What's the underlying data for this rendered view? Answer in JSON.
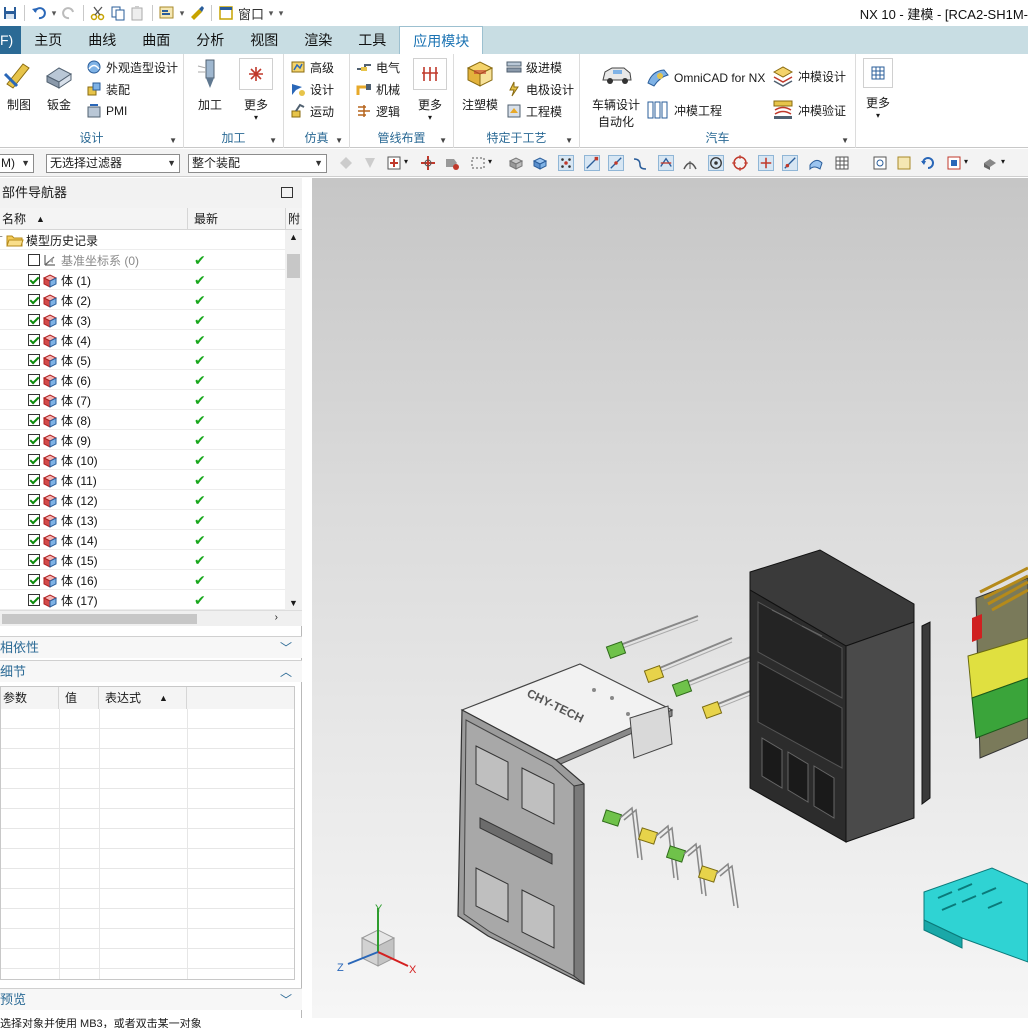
{
  "titlebar": {
    "window_label": "窗口",
    "title": "NX 10 - 建模 - [RCA2-SH1M-"
  },
  "tabs": {
    "file": "F)",
    "items": [
      "主页",
      "曲线",
      "曲面",
      "分析",
      "视图",
      "渲染",
      "工具",
      "应用模块"
    ],
    "active": "应用模块"
  },
  "ribbon": {
    "design": {
      "label": "设计",
      "draft": "制图",
      "sheetmetal": "钣金",
      "shape_studio": "外观造型设计",
      "assembly": "装配",
      "pmi": "PMI"
    },
    "manufacturing": {
      "label": "加工",
      "machining": "加工",
      "more": "更多"
    },
    "simulation": {
      "label": "仿真",
      "advanced": "高级",
      "design": "设计",
      "motion": "运动"
    },
    "routing": {
      "label": "管线布置",
      "electrical": "电气",
      "mechanical": "机械",
      "logical": "逻辑",
      "more": "更多"
    },
    "process": {
      "label": "特定于工艺",
      "mold": "注塑模",
      "progressive": "级进模",
      "electrode": "电极设计",
      "engineering_die": "工程模"
    },
    "automotive": {
      "label": "汽车",
      "vehicle_design_line1": "车辆设计",
      "vehicle_design_line2": "自动化",
      "omnicad": "OmniCAD for NX",
      "die_engineering": "冲模工程",
      "die_design": "冲模设计",
      "die_validation": "冲模验证"
    },
    "extra": {
      "more": "更多"
    }
  },
  "filterbar": {
    "mode": "M)",
    "selection_filter": "无选择过滤器",
    "scope": "整个装配"
  },
  "navigator": {
    "title": "部件导航器",
    "columns": {
      "name": "名称",
      "latest": "最新",
      "attached": "附"
    },
    "root": "模型历史记录",
    "datum": "基准坐标系 (0)",
    "bodies": [
      "体 (1)",
      "体 (2)",
      "体 (3)",
      "体 (4)",
      "体 (5)",
      "体 (6)",
      "体 (7)",
      "体 (8)",
      "体 (9)",
      "体 (10)",
      "体 (11)",
      "体 (12)",
      "体 (13)",
      "体 (14)",
      "体 (15)",
      "体 (16)",
      "体 (17)"
    ],
    "dependencies": "相依性",
    "details": "细节",
    "detail_columns": {
      "param": "参数",
      "value": "值",
      "expression": "表达式"
    },
    "preview": "预览"
  },
  "viewport": {
    "logo_text": "CHY-TECH",
    "axis_x": "X",
    "axis_y": "Y",
    "axis_z": "Z"
  },
  "status": {
    "prompt": "选择对象并使用 MB3，或者双击某一对象"
  },
  "colors": {
    "tab_bar": "#c8dde3",
    "accent": "#2b6a95",
    "check_green": "#19a81d"
  }
}
